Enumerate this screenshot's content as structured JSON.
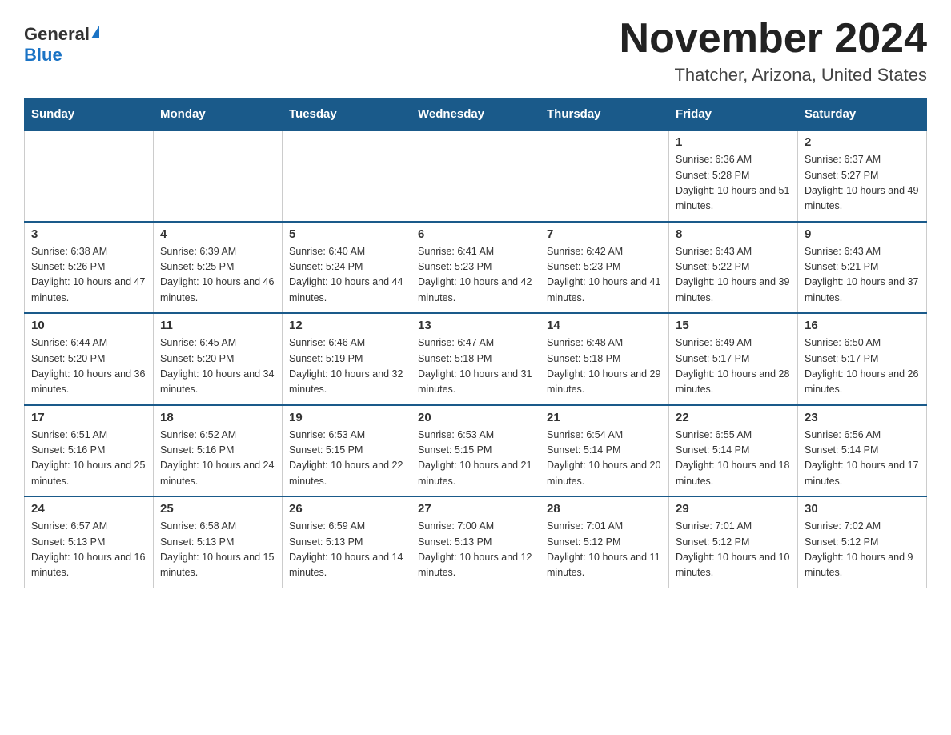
{
  "header": {
    "logo_general": "General",
    "logo_blue": "Blue",
    "title": "November 2024",
    "subtitle": "Thatcher, Arizona, United States"
  },
  "weekdays": [
    "Sunday",
    "Monday",
    "Tuesday",
    "Wednesday",
    "Thursday",
    "Friday",
    "Saturday"
  ],
  "weeks": [
    [
      {
        "day": "",
        "info": ""
      },
      {
        "day": "",
        "info": ""
      },
      {
        "day": "",
        "info": ""
      },
      {
        "day": "",
        "info": ""
      },
      {
        "day": "",
        "info": ""
      },
      {
        "day": "1",
        "info": "Sunrise: 6:36 AM\nSunset: 5:28 PM\nDaylight: 10 hours and 51 minutes."
      },
      {
        "day": "2",
        "info": "Sunrise: 6:37 AM\nSunset: 5:27 PM\nDaylight: 10 hours and 49 minutes."
      }
    ],
    [
      {
        "day": "3",
        "info": "Sunrise: 6:38 AM\nSunset: 5:26 PM\nDaylight: 10 hours and 47 minutes."
      },
      {
        "day": "4",
        "info": "Sunrise: 6:39 AM\nSunset: 5:25 PM\nDaylight: 10 hours and 46 minutes."
      },
      {
        "day": "5",
        "info": "Sunrise: 6:40 AM\nSunset: 5:24 PM\nDaylight: 10 hours and 44 minutes."
      },
      {
        "day": "6",
        "info": "Sunrise: 6:41 AM\nSunset: 5:23 PM\nDaylight: 10 hours and 42 minutes."
      },
      {
        "day": "7",
        "info": "Sunrise: 6:42 AM\nSunset: 5:23 PM\nDaylight: 10 hours and 41 minutes."
      },
      {
        "day": "8",
        "info": "Sunrise: 6:43 AM\nSunset: 5:22 PM\nDaylight: 10 hours and 39 minutes."
      },
      {
        "day": "9",
        "info": "Sunrise: 6:43 AM\nSunset: 5:21 PM\nDaylight: 10 hours and 37 minutes."
      }
    ],
    [
      {
        "day": "10",
        "info": "Sunrise: 6:44 AM\nSunset: 5:20 PM\nDaylight: 10 hours and 36 minutes."
      },
      {
        "day": "11",
        "info": "Sunrise: 6:45 AM\nSunset: 5:20 PM\nDaylight: 10 hours and 34 minutes."
      },
      {
        "day": "12",
        "info": "Sunrise: 6:46 AM\nSunset: 5:19 PM\nDaylight: 10 hours and 32 minutes."
      },
      {
        "day": "13",
        "info": "Sunrise: 6:47 AM\nSunset: 5:18 PM\nDaylight: 10 hours and 31 minutes."
      },
      {
        "day": "14",
        "info": "Sunrise: 6:48 AM\nSunset: 5:18 PM\nDaylight: 10 hours and 29 minutes."
      },
      {
        "day": "15",
        "info": "Sunrise: 6:49 AM\nSunset: 5:17 PM\nDaylight: 10 hours and 28 minutes."
      },
      {
        "day": "16",
        "info": "Sunrise: 6:50 AM\nSunset: 5:17 PM\nDaylight: 10 hours and 26 minutes."
      }
    ],
    [
      {
        "day": "17",
        "info": "Sunrise: 6:51 AM\nSunset: 5:16 PM\nDaylight: 10 hours and 25 minutes."
      },
      {
        "day": "18",
        "info": "Sunrise: 6:52 AM\nSunset: 5:16 PM\nDaylight: 10 hours and 24 minutes."
      },
      {
        "day": "19",
        "info": "Sunrise: 6:53 AM\nSunset: 5:15 PM\nDaylight: 10 hours and 22 minutes."
      },
      {
        "day": "20",
        "info": "Sunrise: 6:53 AM\nSunset: 5:15 PM\nDaylight: 10 hours and 21 minutes."
      },
      {
        "day": "21",
        "info": "Sunrise: 6:54 AM\nSunset: 5:14 PM\nDaylight: 10 hours and 20 minutes."
      },
      {
        "day": "22",
        "info": "Sunrise: 6:55 AM\nSunset: 5:14 PM\nDaylight: 10 hours and 18 minutes."
      },
      {
        "day": "23",
        "info": "Sunrise: 6:56 AM\nSunset: 5:14 PM\nDaylight: 10 hours and 17 minutes."
      }
    ],
    [
      {
        "day": "24",
        "info": "Sunrise: 6:57 AM\nSunset: 5:13 PM\nDaylight: 10 hours and 16 minutes."
      },
      {
        "day": "25",
        "info": "Sunrise: 6:58 AM\nSunset: 5:13 PM\nDaylight: 10 hours and 15 minutes."
      },
      {
        "day": "26",
        "info": "Sunrise: 6:59 AM\nSunset: 5:13 PM\nDaylight: 10 hours and 14 minutes."
      },
      {
        "day": "27",
        "info": "Sunrise: 7:00 AM\nSunset: 5:13 PM\nDaylight: 10 hours and 12 minutes."
      },
      {
        "day": "28",
        "info": "Sunrise: 7:01 AM\nSunset: 5:12 PM\nDaylight: 10 hours and 11 minutes."
      },
      {
        "day": "29",
        "info": "Sunrise: 7:01 AM\nSunset: 5:12 PM\nDaylight: 10 hours and 10 minutes."
      },
      {
        "day": "30",
        "info": "Sunrise: 7:02 AM\nSunset: 5:12 PM\nDaylight: 10 hours and 9 minutes."
      }
    ]
  ]
}
